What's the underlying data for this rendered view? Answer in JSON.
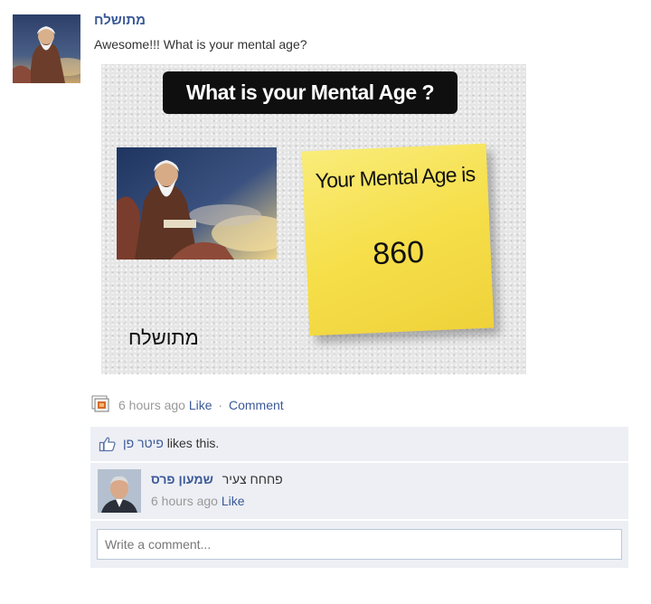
{
  "post": {
    "author": "מתושלח",
    "text": "Awesome!!! What is your mental age?",
    "image": {
      "title": "What is your Mental Age ?",
      "name_caption": "מתושלח",
      "sticky_label": "Your Mental Age is",
      "sticky_value": "860"
    },
    "meta": {
      "time": "6 hours ago",
      "like_label": "Like",
      "separator": "·",
      "comment_label": "Comment"
    }
  },
  "likes": {
    "name": "פיטר פן",
    "suffix": "likes this."
  },
  "comment": {
    "author": "שמעון פרס",
    "text": "פחחח צעיר",
    "time": "6 hours ago",
    "like_label": "Like"
  },
  "comment_input": {
    "placeholder": "Write a comment..."
  },
  "colors": {
    "link": "#3b5998",
    "ufi_background": "#edeff4",
    "sticky_note": "#f6df4a"
  },
  "icons": {
    "action": "app-photo-icon",
    "like": "thumbs-up-icon"
  }
}
